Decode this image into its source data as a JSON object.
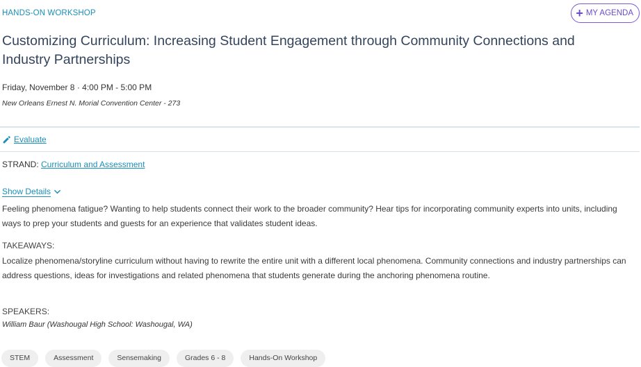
{
  "session": {
    "type": "HANDS-ON WORKSHOP",
    "title": "Customizing Curriculum: Increasing Student Engagement through Community Connections and Industry Partnerships",
    "datetime": "Friday, November 8 · 4:00 PM - 5:00 PM",
    "location": "New Orleans Ernest N. Morial Convention Center - 273"
  },
  "agenda_button": {
    "icon": "plus-icon",
    "label": "MY AGENDA"
  },
  "evaluate": {
    "icon": "pencil-icon",
    "label": "Evaluate"
  },
  "strand": {
    "label": "STRAND:",
    "value": "Curriculum and Assessment"
  },
  "details": {
    "toggle_label": "Show Details",
    "toggle_icon": "chevron-down-icon",
    "description": "Feeling phenomena fatigue? Wanting to help students connect their work to the broader community? Hear tips for incorporating community experts into units, including ways to prep your students and guests for an experience that validates student ideas."
  },
  "takeaways": {
    "label": "TAKEAWAYS:",
    "text": "Localize phenomena/storyline curriculum without having to rewrite the entire unit with a different local phenomena. Community connections and industry partnerships can address questions, ideas for investigations and related phenomena that students generate during the anchoring phenomena routine."
  },
  "speakers": {
    "label": "SPEAKERS:",
    "list": [
      "William Baur (Washougal High School: Washougal, WA)"
    ]
  },
  "tags": [
    "STEM",
    "Assessment",
    "Sensemaking",
    "Grades 6 - 8",
    "Hands-On Workshop"
  ],
  "colors": {
    "accent": "#1a8fb8",
    "agenda": "#6a4ccc",
    "title": "#33445c"
  }
}
